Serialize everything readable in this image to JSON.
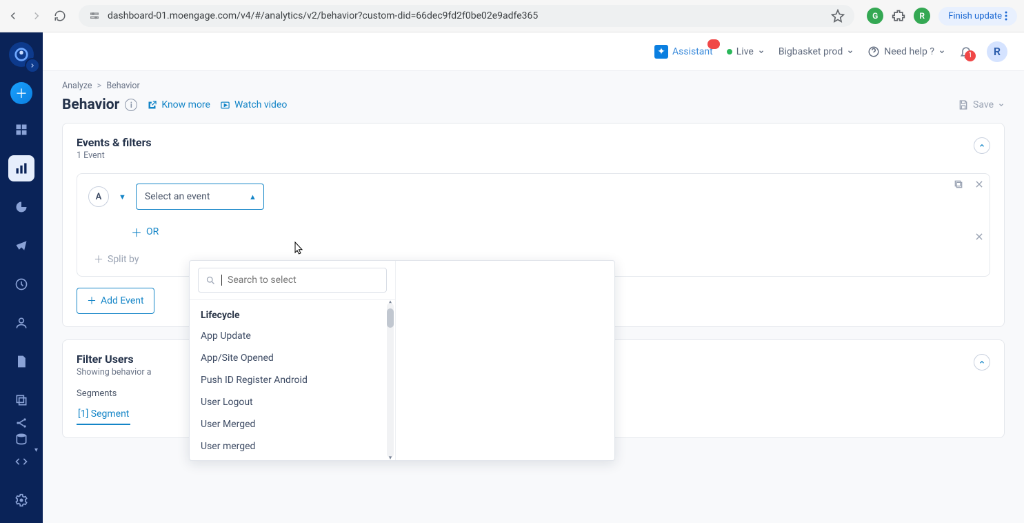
{
  "chrome": {
    "url": "dashboard-01.moengage.com/v4/#/analytics/v2/behavior?custom-did=66dec9fd2f0be02e9adfe365",
    "finish_update": "Finish update",
    "avatar_letter": "R"
  },
  "header": {
    "assistant": "Assistant",
    "live": "Live",
    "workspace": "Bigbasket prod",
    "need_help": "Need help ?",
    "bell_badge": "1",
    "avatar_letter": "R"
  },
  "breadcrumb": {
    "l1": "Analyze",
    "l2": "Behavior"
  },
  "page": {
    "title": "Behavior",
    "know_more": "Know more",
    "watch_video": "Watch video",
    "save": "Save"
  },
  "events_card": {
    "title": "Events & filters",
    "subtitle": "1 Event",
    "event_label": "A",
    "select_placeholder": "Select an event",
    "or_label": "OR",
    "split_label": "Split by",
    "add_event_label": "Add Event"
  },
  "dropdown": {
    "search_placeholder": "Search to select",
    "group": "Lifecycle",
    "items": [
      "App Update",
      "App/Site Opened",
      "Push ID Register Android",
      "User Logout",
      "User Merged",
      "User merged"
    ]
  },
  "filter_card": {
    "title": "Filter Users",
    "subtitle": "Showing behavior a",
    "segments_label": "Segments",
    "tab_label": "[1] Segment"
  }
}
